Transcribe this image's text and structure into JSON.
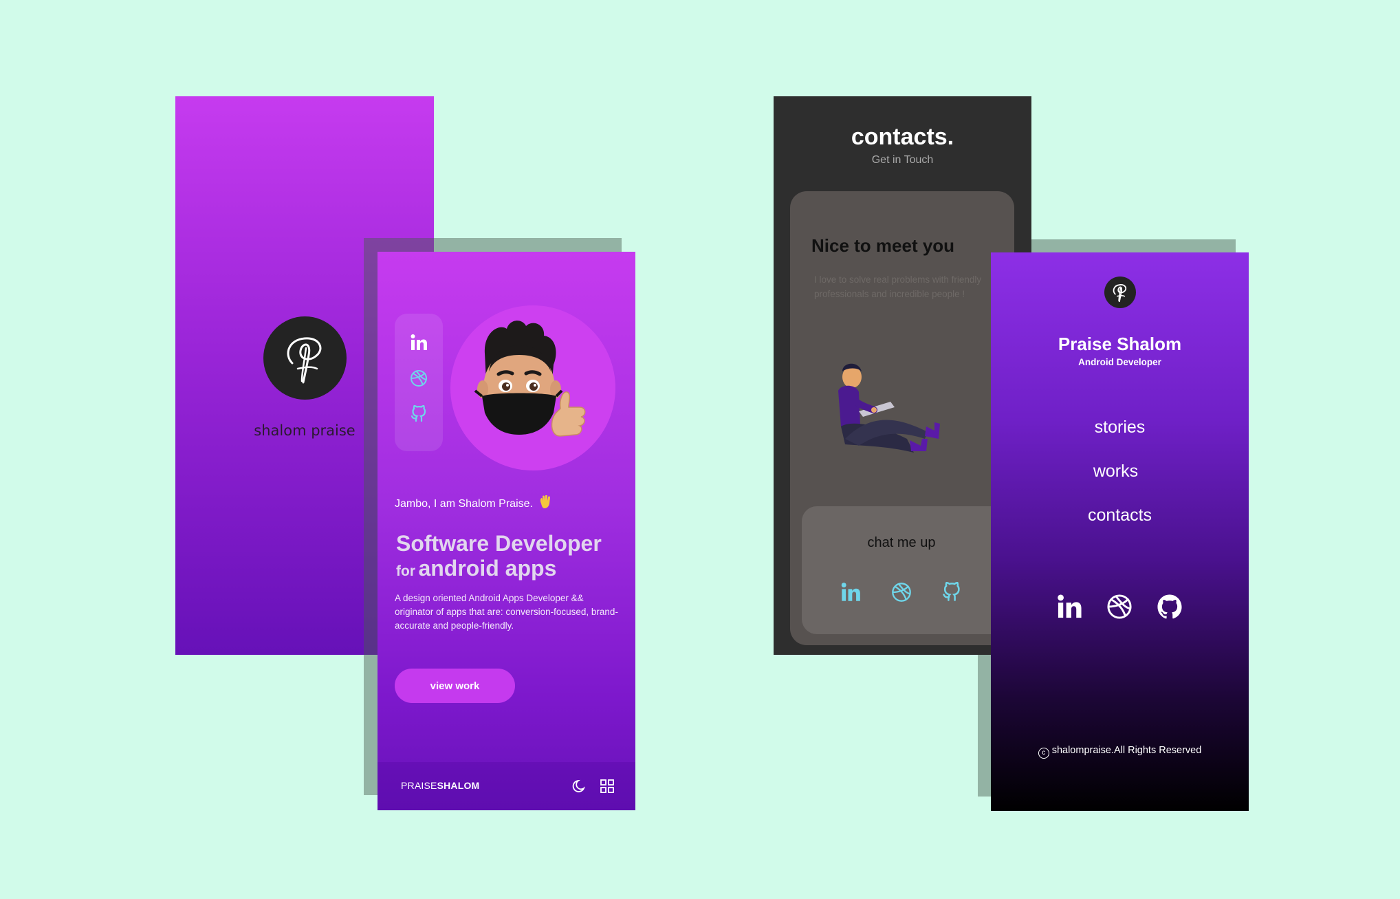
{
  "colors": {
    "background": "#d1fbea",
    "purple_top": "#c63bef",
    "purple_bottom": "#6612b8",
    "accent": "#c53aee",
    "teal_icon": "#6fd6ea",
    "dark_screen": "#2e2e2e"
  },
  "splash": {
    "name": "shalom praise"
  },
  "home": {
    "social_icons": [
      "linkedin-icon",
      "dribbble-icon",
      "github-icon"
    ],
    "greeting": "Jambo, I am Shalom Praise.",
    "headline_line1": "Software Developer",
    "headline_for": "for",
    "headline_apps": "android apps",
    "bio": "A design oriented Android Apps Developer && originator of apps that are: conversion-focused, brand-accurate and people-friendly.",
    "cta": "view work",
    "brand_light": "PRAISE",
    "brand_bold": "SHALOM"
  },
  "contacts": {
    "title": "contacts.",
    "subtitle": "Get in Touch",
    "card_title": "Nice to meet you",
    "card_text": "I love to solve real problems with friendly professionals and incredible people !",
    "chat_label": "chat me up"
  },
  "menu": {
    "name": "Praise Shalom",
    "role": "Android Developer",
    "links": [
      "stories",
      "works",
      "contacts"
    ],
    "copyright": "shalompraise.All Rights Reserved"
  }
}
